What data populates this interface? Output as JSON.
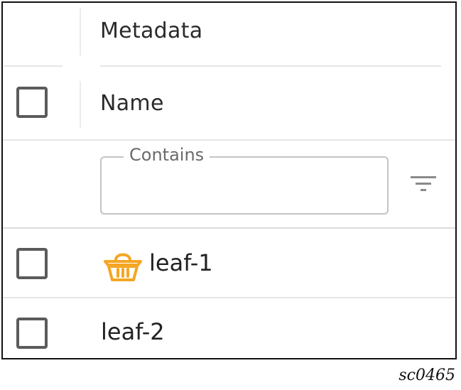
{
  "header": {
    "group_title": "Metadata",
    "column_name": "Name"
  },
  "filter": {
    "label": "Contains",
    "value": "",
    "icon": "filter-icon"
  },
  "rows": [
    {
      "label": "leaf-1",
      "icon": "basket-icon",
      "icon_color": "#f5a623"
    },
    {
      "label": "leaf-2",
      "icon": ""
    }
  ],
  "figure_caption": "sc0465"
}
